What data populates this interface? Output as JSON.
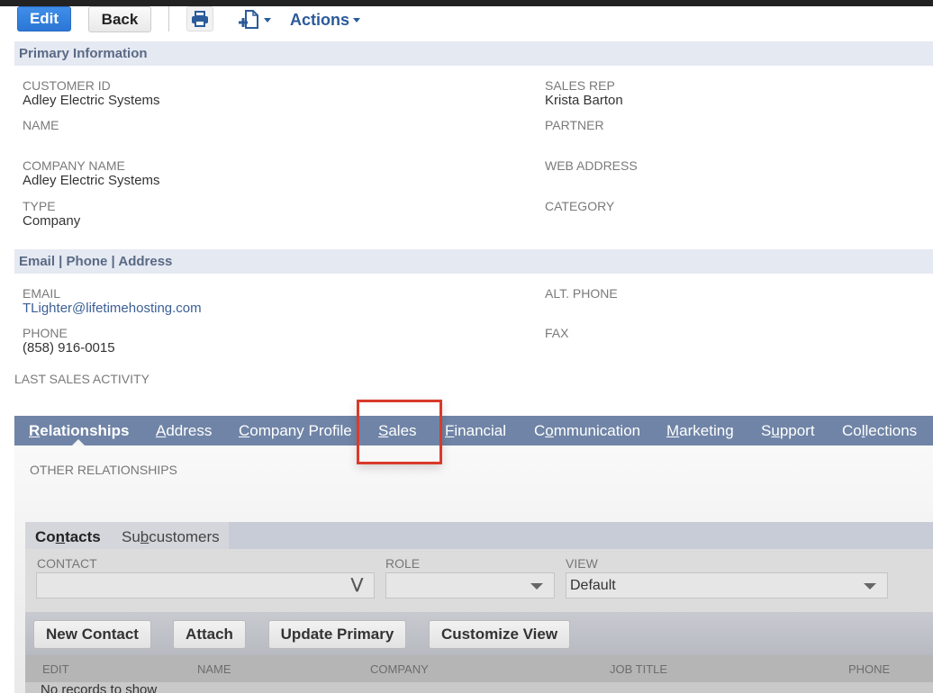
{
  "toolbar": {
    "edit_label": "Edit",
    "back_label": "Back",
    "print_icon": "printer-icon",
    "new_icon": "new-document-icon",
    "actions_label": "Actions"
  },
  "primary_info": {
    "header": "Primary Information",
    "left": [
      {
        "label": "CUSTOMER ID",
        "value": "Adley Electric Systems"
      },
      {
        "label": "NAME",
        "value": ""
      },
      {
        "label": "COMPANY NAME",
        "value": "Adley Electric Systems"
      },
      {
        "label": "TYPE",
        "value": "Company"
      }
    ],
    "right": [
      {
        "label": "SALES REP",
        "value": "Krista Barton"
      },
      {
        "label": "PARTNER",
        "value": ""
      },
      {
        "label": "WEB ADDRESS",
        "value": ""
      },
      {
        "label": "CATEGORY",
        "value": ""
      }
    ]
  },
  "contact_info": {
    "header": "Email | Phone | Address",
    "left": [
      {
        "label": "EMAIL",
        "value": "TLighter@lifetimehosting.com"
      },
      {
        "label": "PHONE",
        "value": "(858) 916-0015"
      }
    ],
    "right": [
      {
        "label": "ALT. PHONE",
        "value": ""
      },
      {
        "label": "FAX",
        "value": ""
      }
    ],
    "last_sales_activity_label": "LAST SALES ACTIVITY"
  },
  "subtabs": [
    {
      "pre": "",
      "u": "R",
      "post": "elationships",
      "active": true
    },
    {
      "pre": "",
      "u": "A",
      "post": "ddress",
      "active": false
    },
    {
      "pre": "",
      "u": "C",
      "post": "ompany Profile",
      "active": false
    },
    {
      "pre": "",
      "u": "S",
      "post": "ales",
      "active": false,
      "highlighted": true
    },
    {
      "pre": "",
      "u": "F",
      "post": "inancial",
      "active": false
    },
    {
      "pre": "C",
      "u": "o",
      "post": "mmunication",
      "active": false
    },
    {
      "pre": "",
      "u": "M",
      "post": "arketing",
      "active": false
    },
    {
      "pre": "S",
      "u": "u",
      "post": "pport",
      "active": false
    },
    {
      "pre": "Co",
      "u": "l",
      "post": "lections",
      "active": false
    }
  ],
  "relationships": {
    "other_label": "OTHER RELATIONSHIPS",
    "tabs": [
      {
        "pre": "Co",
        "u": "n",
        "post": "tacts",
        "active": true
      },
      {
        "pre": "Su",
        "u": "b",
        "post": "customers",
        "active": false
      }
    ],
    "filters": {
      "contact": {
        "label": "CONTACT",
        "value": ""
      },
      "role": {
        "label": "ROLE",
        "value": ""
      },
      "view": {
        "label": "VIEW",
        "value": "Default"
      }
    },
    "buttons": {
      "new_contact": "New Contact",
      "attach": "Attach",
      "update_primary": "Update Primary",
      "customize_view": "Customize View"
    },
    "columns": [
      "EDIT",
      "NAME",
      "COMPANY",
      "JOB TITLE",
      "PHONE"
    ],
    "empty_message": "No records to show"
  }
}
